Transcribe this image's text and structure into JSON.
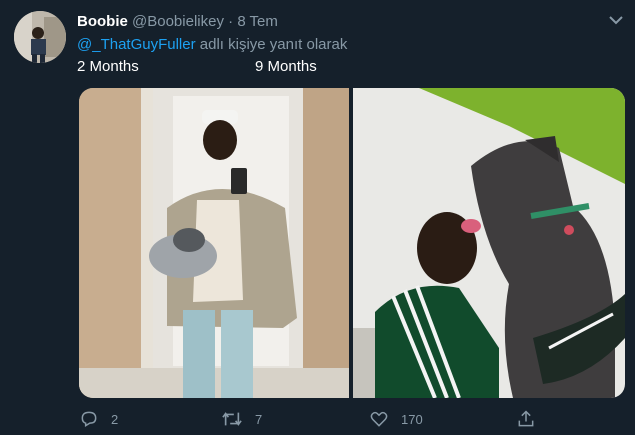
{
  "tweet": {
    "display_name": "Boobie",
    "handle": "@Boobielikey",
    "separator": "·",
    "date": "8 Tem",
    "reply_mention": "@_ThatGuyFuller",
    "reply_text": " adlı kişiye yanıt olarak",
    "photo_label_left": "2 Months",
    "photo_label_right": "9 Months"
  },
  "actions": {
    "reply_count": "2",
    "retweet_count": "7",
    "like_count": "170"
  },
  "icons": {
    "reply": "reply-icon",
    "retweet": "retweet-icon",
    "like": "heart-icon",
    "share": "share-icon",
    "menu": "chevron-down-icon"
  },
  "colors": {
    "background": "#15202b",
    "secondary_text": "#8899a6",
    "link": "#1da1f2"
  }
}
